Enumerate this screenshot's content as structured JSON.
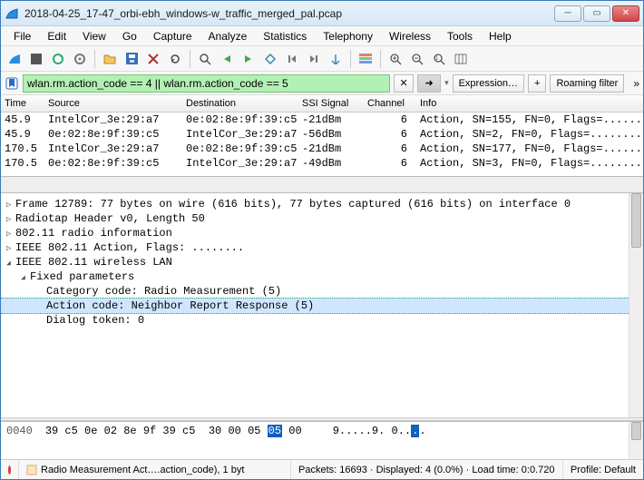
{
  "window": {
    "title": "2018-04-25_17-47_orbi-ebh_windows-w_traffic_merged_pal.pcap"
  },
  "menu": [
    "File",
    "Edit",
    "View",
    "Go",
    "Capture",
    "Analyze",
    "Statistics",
    "Telephony",
    "Wireless",
    "Tools",
    "Help"
  ],
  "filter": {
    "text": "wlan.rm.action_code == 4 || wlan.rm.action_code == 5",
    "expression": "Expression…",
    "plus": "+",
    "roaming": "Roaming filter",
    "more": "»"
  },
  "columns": {
    "time": "Time",
    "source": "Source",
    "dest": "Destination",
    "ssi": "SSI Signal",
    "chan": "Channel",
    "info": "Info"
  },
  "packets": [
    {
      "time": "45.9",
      "src": "IntelCor_3e:29:a7",
      "dst": "0e:02:8e:9f:39:c5",
      "ssi": "-21dBm",
      "chan": "6",
      "info": "Action, SN=155, FN=0, Flags=........"
    },
    {
      "time": "45.9",
      "src": "0e:02:8e:9f:39:c5",
      "dst": "IntelCor_3e:29:a7",
      "ssi": "-56dBm",
      "chan": "6",
      "info": "Action, SN=2, FN=0, Flags=........"
    },
    {
      "time": "170.5",
      "src": "IntelCor_3e:29:a7",
      "dst": "0e:02:8e:9f:39:c5",
      "ssi": "-21dBm",
      "chan": "6",
      "info": "Action, SN=177, FN=0, Flags=........"
    },
    {
      "time": "170.5",
      "src": "0e:02:8e:9f:39:c5",
      "dst": "IntelCor_3e:29:a7",
      "ssi": "-49dBm",
      "chan": "6",
      "info": "Action, SN=3, FN=0, Flags=........"
    }
  ],
  "details": {
    "frame": "Frame 12789: 77 bytes on wire (616 bits), 77 bytes captured (616 bits) on interface 0",
    "radiotap": "Radiotap Header v0, Length 50",
    "radio": "802.11 radio information",
    "action": "IEEE 802.11 Action, Flags: ........",
    "wlan": "IEEE 802.11 wireless LAN",
    "fixed": "Fixed parameters",
    "cat": "Category code: Radio Measurement (5)",
    "acode": "Action code: Neighbor Report Response (5)",
    "dialog": "Dialog token: 0"
  },
  "hex": {
    "addr": "0040",
    "bytes_a": "39 c5 0e 02 8e 9f 39 c5",
    "bytes_b": "30 00 05",
    "sel": "05",
    "bytes_c": "00",
    "ascii_a": "9.....9. 0..",
    "ascii_sel": ".",
    "ascii_b": "."
  },
  "status": {
    "field": "Radio Measurement Act….action_code), 1 byt",
    "packets": "Packets: 16693 · Displayed: 4 (0.0%) · Load time: 0:0.720",
    "profile": "Profile: Default"
  }
}
